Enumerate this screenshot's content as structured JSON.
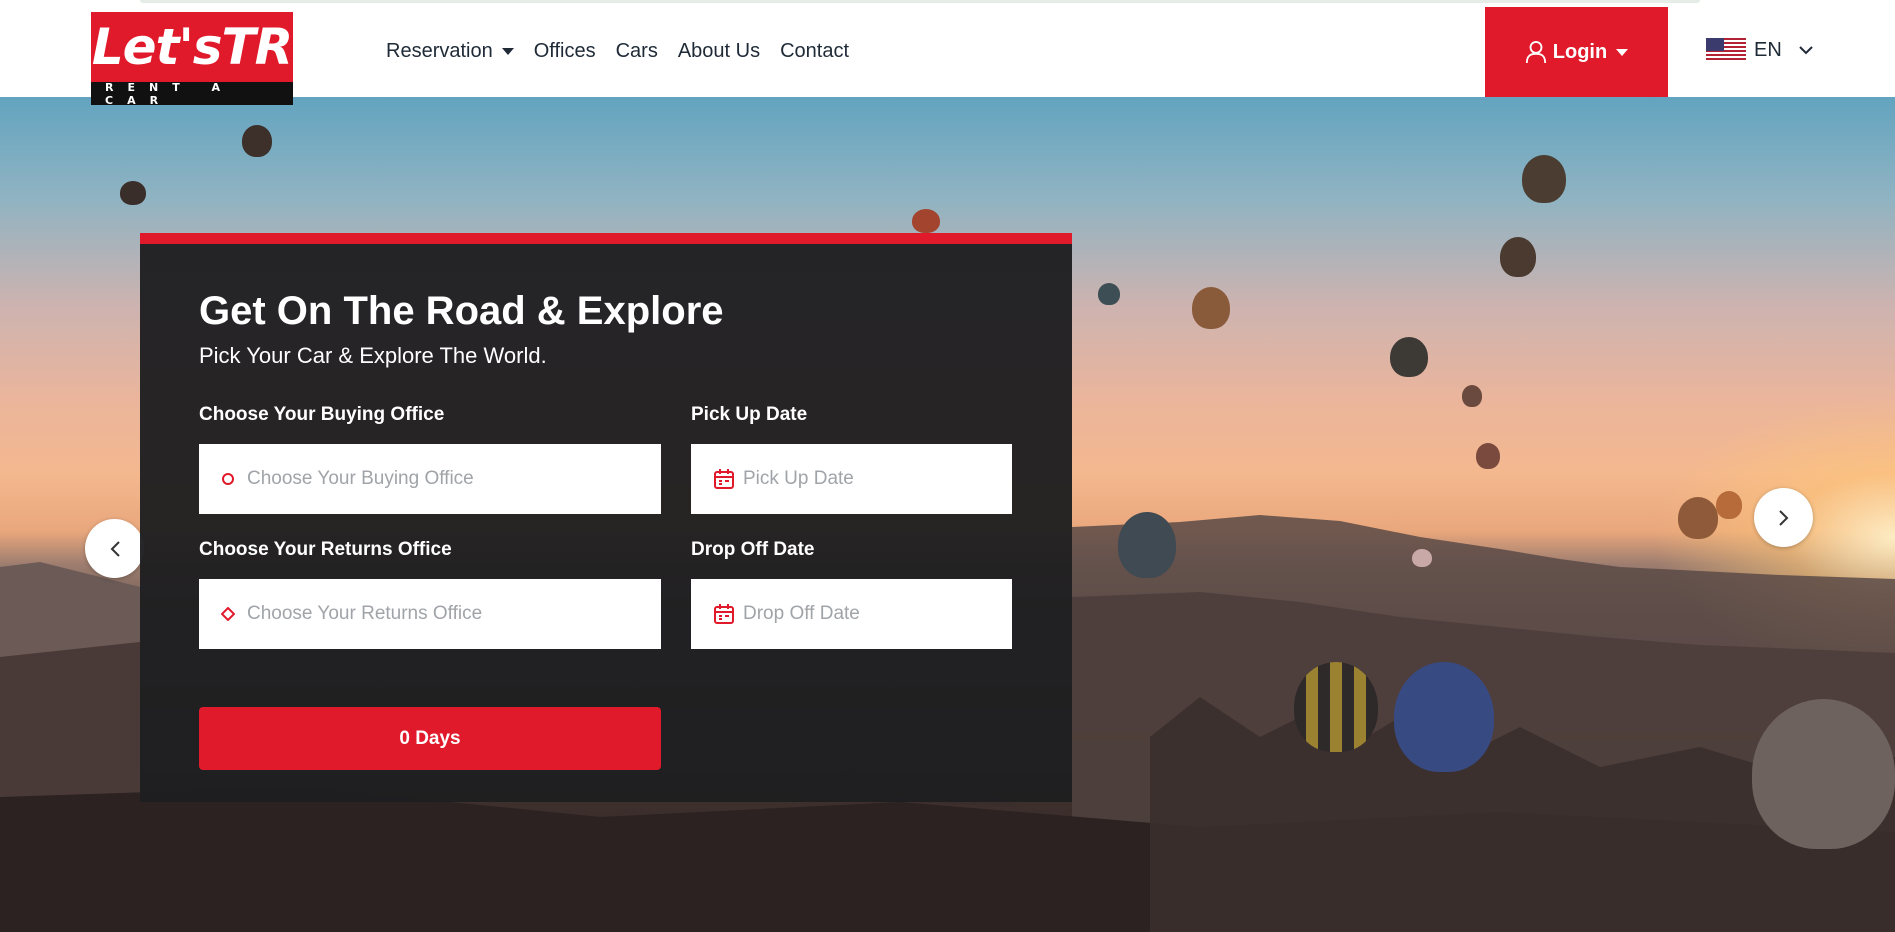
{
  "brand": {
    "logo_main": "Let'sTR",
    "logo_sub": "RENT A CAR",
    "accent": "#e11a2b"
  },
  "nav": {
    "items": [
      {
        "label": "Reservation",
        "dropdown": true
      },
      {
        "label": "Offices"
      },
      {
        "label": "Cars"
      },
      {
        "label": "About Us"
      },
      {
        "label": "Contact"
      }
    ]
  },
  "account": {
    "login_label": "Login",
    "icon": "user-icon"
  },
  "language": {
    "code": "EN",
    "flag": "us-flag-icon"
  },
  "hero": {
    "title": "Get On The Road & Explore",
    "subtitle": "Pick Your Car & Explore The World.",
    "form": {
      "buying_office": {
        "label": "Choose Your Buying Office",
        "placeholder": "Choose Your Buying Office",
        "icon": "circle-icon"
      },
      "pickup_date": {
        "label": "Pick Up Date",
        "placeholder": "Pick Up Date",
        "icon": "calendar-icon"
      },
      "returns_office": {
        "label": "Choose Your Returns Office",
        "placeholder": "Choose Your Returns Office",
        "icon": "diamond-icon"
      },
      "dropoff_date": {
        "label": "Drop Off Date",
        "placeholder": "Drop Off Date",
        "icon": "calendar-icon"
      },
      "days_button": "0 Days"
    },
    "carousel": {
      "prev_icon": "chevron-left-icon",
      "next_icon": "chevron-right-icon"
    }
  }
}
